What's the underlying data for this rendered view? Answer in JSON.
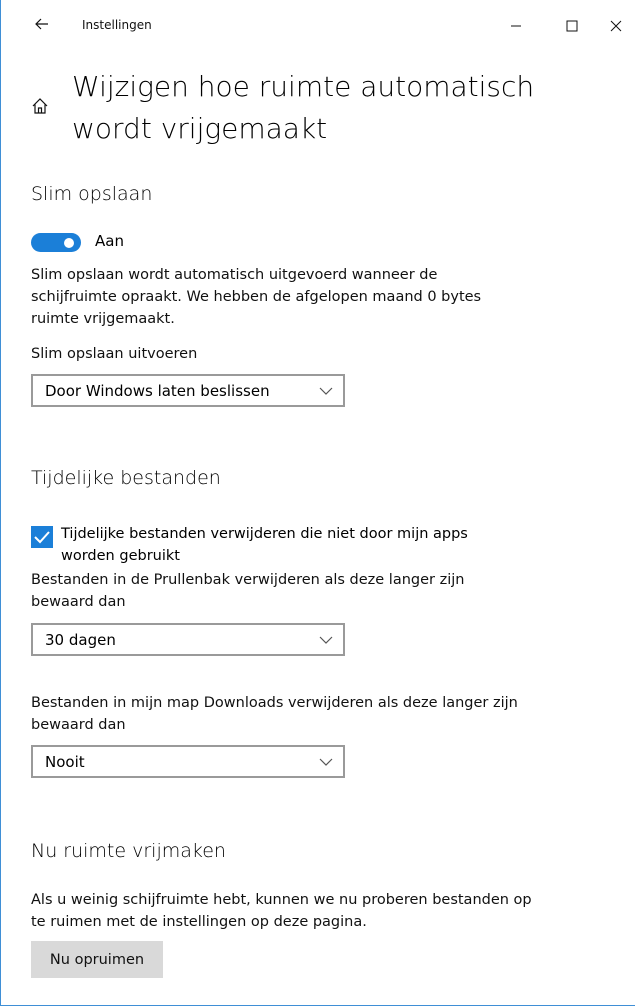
{
  "titlebar": {
    "title": "Instellingen",
    "back_icon": "arrow-left-icon",
    "minimize_icon": "minimize-icon",
    "maximize_icon": "maximize-icon",
    "close_icon": "close-icon"
  },
  "page": {
    "home_icon": "home-icon",
    "title": "Wijzigen hoe ruimte automatisch wordt vrijgemaakt"
  },
  "smart_storage": {
    "heading": "Slim opslaan",
    "toggle_label": "Aan",
    "toggle_on": true,
    "description": "Slim opslaan wordt automatisch uitgevoerd wanneer de schijfruimte opraakt. We hebben de afgelopen maand 0 bytes ruimte vrijgemaakt.",
    "run_label": "Slim opslaan uitvoeren",
    "run_select": "Door Windows laten beslissen"
  },
  "temp_files": {
    "heading": "Tijdelijke bestanden",
    "checkbox_label": "Tijdelijke bestanden verwijderen die niet door mijn apps worden gebruikt",
    "checkbox_checked": true,
    "recycle_label": "Bestanden in de Prullenbak verwijderen als deze langer zijn bewaard dan",
    "recycle_select": "30 dagen",
    "downloads_label": "Bestanden in mijn map Downloads verwijderen als deze langer zijn bewaard dan",
    "downloads_select": "Nooit"
  },
  "free_now": {
    "heading": "Nu ruimte vrijmaken",
    "description": "Als u weinig schijfruimte hebt, kunnen we nu proberen bestanden op te ruimen met de instellingen op deze pagina.",
    "button_label": "Nu opruimen"
  },
  "colors": {
    "accent": "#1b7fd8",
    "button_bg": "#d9d9d9",
    "border": "#9a9a9a"
  }
}
